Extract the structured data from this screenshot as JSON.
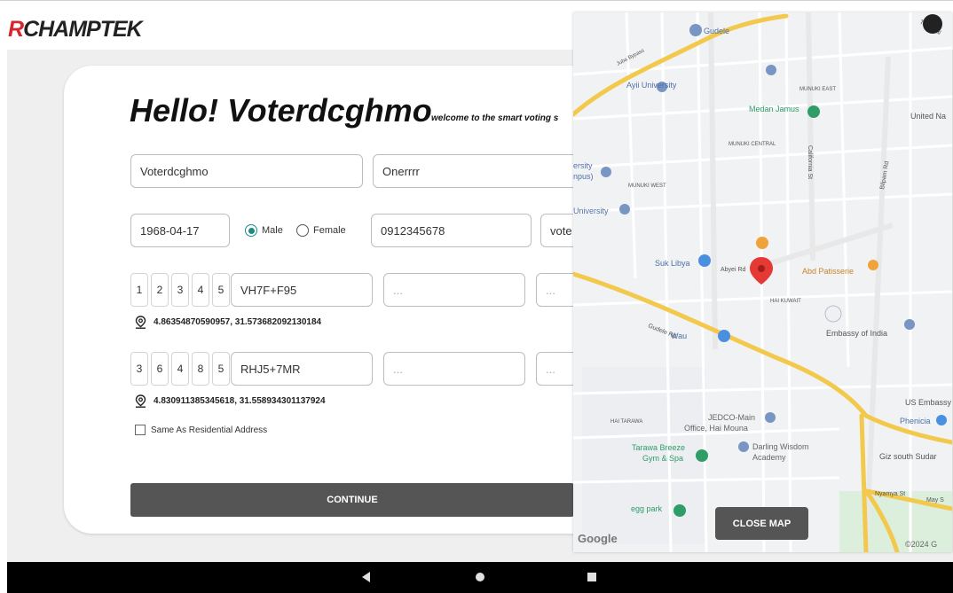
{
  "header": {
    "logo_r": "R",
    "logo_rest": "CHAMPTEK"
  },
  "form": {
    "greeting": "Hello! Voterdcghmo",
    "subtitle": "welcome to the smart voting s",
    "first_name": "Voterdcghmo",
    "last_name": "Onerrrr",
    "dob": "1968-04-17",
    "gender_options": [
      {
        "label": "Male",
        "selected": true
      },
      {
        "label": "Female",
        "selected": false
      }
    ],
    "phone": "0912345678",
    "truncated_field": "vote",
    "residential": {
      "digits": [
        "1",
        "2",
        "3",
        "4",
        "5"
      ],
      "plus_code": "VH7F+F95",
      "extra_1": "...",
      "extra_2": "...",
      "coordinates": "4.86354870590957, 31.573682092130184"
    },
    "polling": {
      "digits": [
        "3",
        "6",
        "4",
        "8",
        "5"
      ],
      "plus_code": "RHJ5+7MR",
      "extra_1": "...",
      "extra_2": "...",
      "coordinates": "4.830911385345618, 31.558934301137924"
    },
    "same_as_residential_label": "Same As Residential Address",
    "continue_label": "CONTINUE"
  },
  "map": {
    "close_label": "CLOSE MAP",
    "google_label": "Google",
    "copyright": "©2024 G",
    "labels": {
      "gudele": "Gudele",
      "juba_bypass": "Juba Bypass",
      "ayii_university": "Ayii University",
      "munuki_east": "MUNUKI EAST",
      "medan_jamus": "Medan Jamus",
      "united_na": "United Na",
      "munuki_central": "MUNUKI CENTRAL",
      "munuki_west": "MUNUKI WEST",
      "ersity": "ersity",
      "npus": "npus)",
      "university": "University",
      "suk_libya": "Suk Libya",
      "abyei_rd": "Abyei Rd",
      "abd_patisserie": "Abd Patisserie",
      "hai_kuwait": "HAI KUWAIT",
      "wau": "Wau",
      "gudele_rd": "Gudele Rd",
      "embassy_india": "Embassy of India",
      "us_embassy": "US Embassy",
      "phenicia": "Phenicia",
      "hai_tarawa": "HAI TARAWA",
      "jedco": "JEDCO-Main",
      "jedco2": "Office, Hai Mouna",
      "darling": "Darling Wisdom",
      "darling2": "Academy",
      "tarawa_breeze": "Tarawa Breeze",
      "tarawa_breeze2": "Gym & Spa",
      "giz": "Giz south Sudar",
      "egg_park": "egg park",
      "nyamya": "Nyamya St",
      "may_s": "May S",
      "california_st": "California St",
      "bilpam_rd": "Bilpam Rd",
      "terminal": "Terminal"
    }
  },
  "colors": {
    "brand_red": "#d6262b",
    "radio_teal": "#1f8a85",
    "button_gray": "#555555",
    "map_pin": "#e53935",
    "road_yellow": "#f2c94c"
  }
}
